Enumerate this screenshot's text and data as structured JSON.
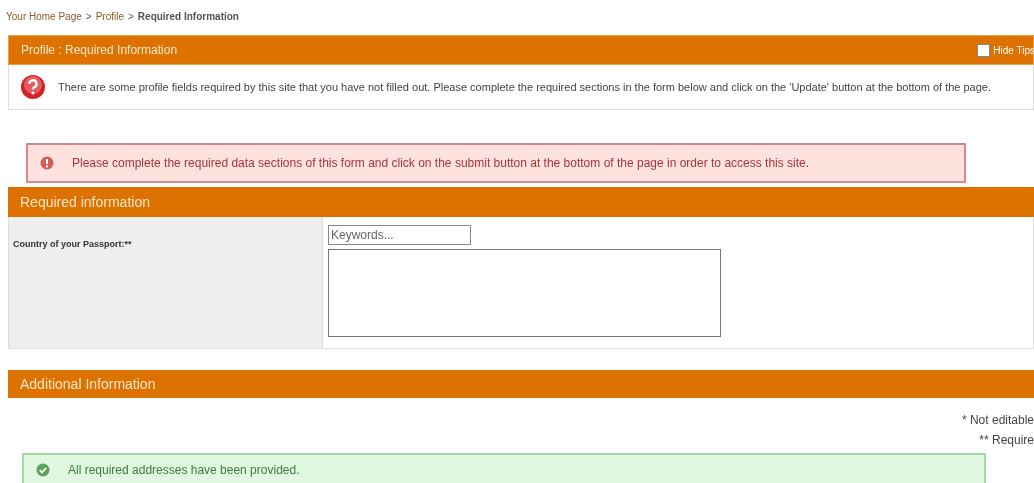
{
  "breadcrumb": [
    {
      "label": "Your Home Page",
      "kind": "link"
    },
    {
      "separator": ">",
      "label": "Profile",
      "kind": "link"
    },
    {
      "separator": ">",
      "label": "Required Information",
      "kind": "current"
    }
  ],
  "profile_panel": {
    "title": "Profile : Required Information",
    "hide_tips": {
      "label": "Hide Tips",
      "checked": false
    },
    "tip": "There are some profile fields required by this site that you have not filled out. Please complete the required sections in the form below and click on the 'Update' button at the bottom of the page."
  },
  "error_message": "Please complete the required data sections of this form and click on the submit button at the bottom of the page in order to access this site.",
  "required_section": {
    "title": "Required information",
    "fields": [
      {
        "label": "Country of your Passport:**",
        "placeholder": "Keywords..."
      }
    ]
  },
  "additional_section": {
    "title": "Additional Information",
    "legend": [
      "* Not editable",
      "** Require"
    ],
    "success_message": "All required addresses have been provided."
  }
}
